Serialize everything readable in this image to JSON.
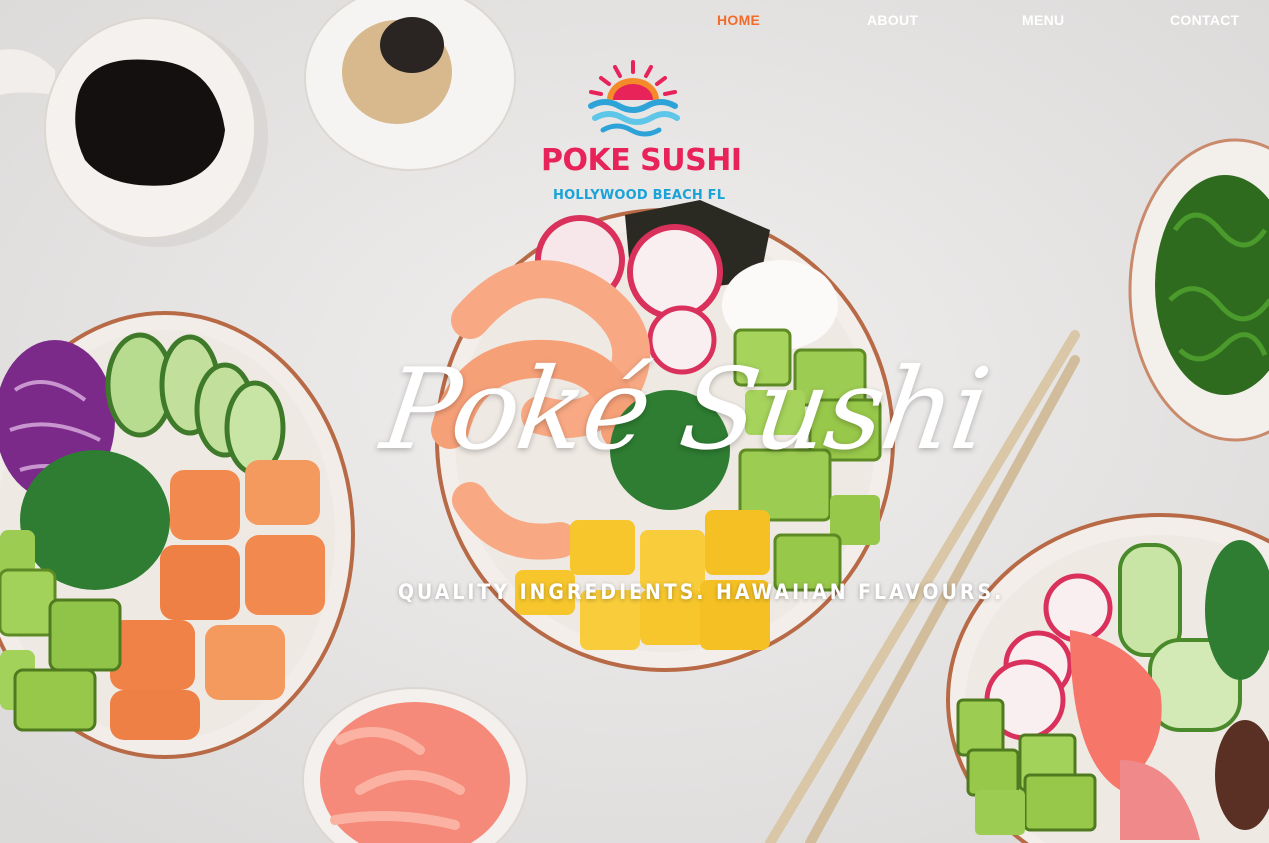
{
  "nav": {
    "items": [
      {
        "label": "HOME",
        "active": true
      },
      {
        "label": "ABOUT",
        "active": false
      },
      {
        "label": "MENU",
        "active": false
      },
      {
        "label": "CONTACT",
        "active": false
      }
    ],
    "active_color": "#f26b2a",
    "inactive_color": "#ffffff"
  },
  "logo": {
    "title": "POKE SUSHI",
    "subtitle": "HOLLYWOOD BEACH FL",
    "title_color": "#e8235a",
    "subtitle_color": "#19a3d8",
    "icon": "sun-waves-icon"
  },
  "hero": {
    "title": "Poké Sushi",
    "tagline": "QUALITY INGREDIENTS. HAWAIIAN FLAVOURS."
  },
  "colors": {
    "background": "#e9e7e6",
    "salmon": "#f28a4f",
    "avocado": "#98c84a",
    "mango": "#f6c62c",
    "seaweed": "#2e7d32",
    "shrimp": "#f8a983",
    "cabbage": "#7b2a8a"
  }
}
